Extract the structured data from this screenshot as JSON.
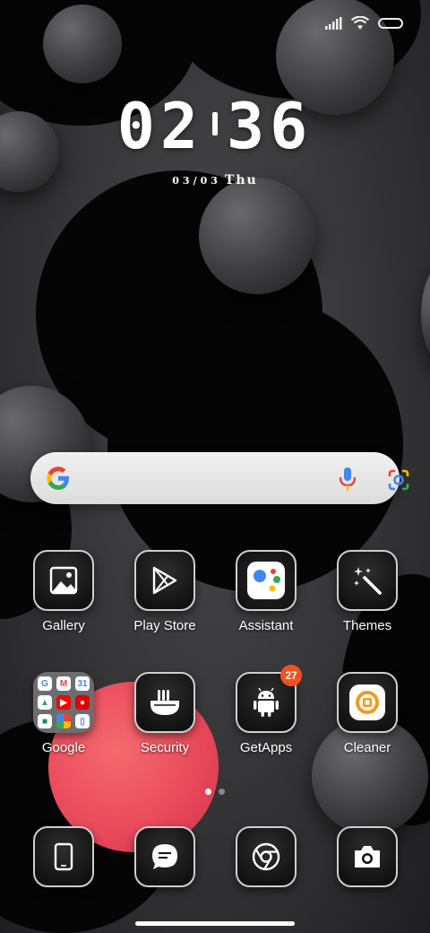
{
  "clock": {
    "hour": "02",
    "minute": "36"
  },
  "date": {
    "day": "03/03",
    "weekday": "Thu"
  },
  "apps_row1": [
    {
      "label": "Gallery",
      "icon": "gallery-icon"
    },
    {
      "label": "Play Store",
      "icon": "play-store-icon"
    },
    {
      "label": "Assistant",
      "icon": "assistant-icon"
    },
    {
      "label": "Themes",
      "icon": "themes-wand-icon"
    }
  ],
  "apps_row2": [
    {
      "label": "Google",
      "icon": "google-folder-icon"
    },
    {
      "label": "Security",
      "icon": "security-icon"
    },
    {
      "label": "GetApps",
      "icon": "android-icon",
      "badge": "27"
    },
    {
      "label": "Cleaner",
      "icon": "cleaner-icon"
    }
  ],
  "dock": [
    {
      "icon": "phone-icon"
    },
    {
      "icon": "messages-icon"
    },
    {
      "icon": "chrome-icon"
    },
    {
      "icon": "camera-icon"
    }
  ],
  "colors": {
    "badge": "#f4511e",
    "accent_pink": "#e8485a"
  }
}
